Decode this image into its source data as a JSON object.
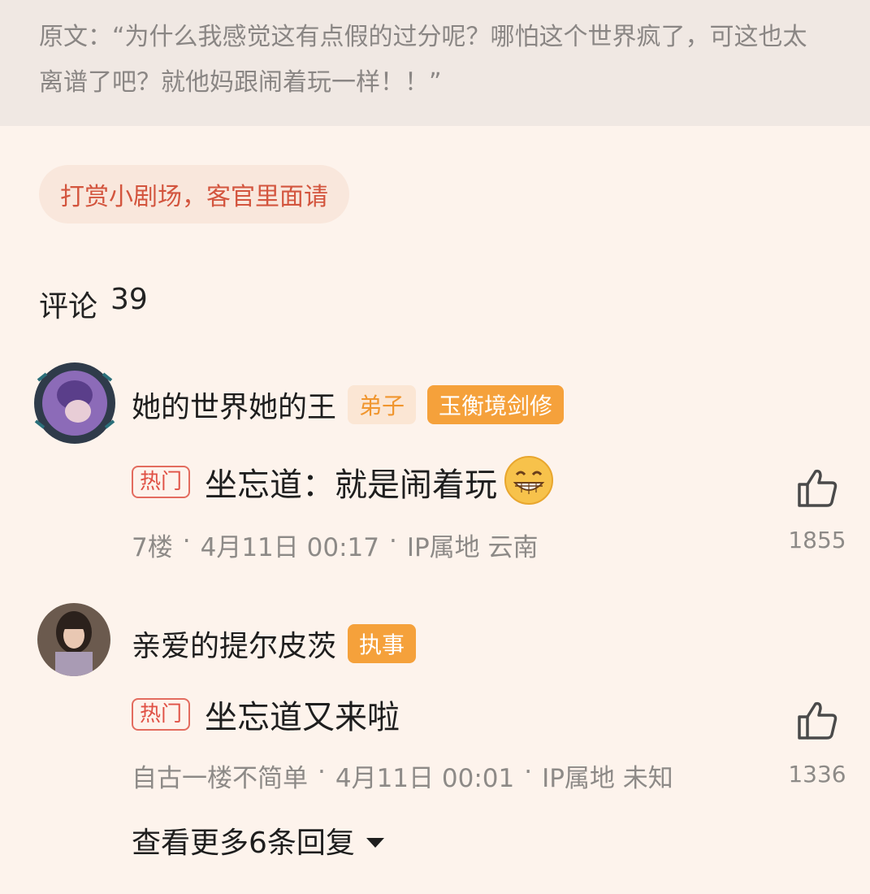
{
  "quote": {
    "text": "原文：“为什么我感觉这有点假的过分呢？哪怕这个世界疯了，可这也太离谱了吧？就他妈跟闹着玩一样！！”"
  },
  "reward": {
    "label": "打赏小剧场，客官里面请"
  },
  "comments_header": {
    "label": "评论",
    "count": "39"
  },
  "comments": [
    {
      "username": "她的世界她的王",
      "badges": [
        "弟子",
        "玉衡境剑修"
      ],
      "hot_tag": "热门",
      "text": "坐忘道：就是闹着玩",
      "meta": {
        "floor": "7楼",
        "datetime": "4月11日 00:17",
        "ip": "IP属地 云南"
      },
      "likes": "1855"
    },
    {
      "username": "亲爱的提尔皮茨",
      "badges": [
        "执事"
      ],
      "hot_tag": "热门",
      "text": "坐忘道又来啦",
      "meta": {
        "floor": "自古一楼不简单",
        "datetime": "4月11日 00:01",
        "ip": "IP属地 未知"
      },
      "likes": "1336"
    }
  ],
  "more_replies": {
    "label": "查看更多6条回复"
  },
  "colors": {
    "background": "#fdf3ec",
    "badge_orange": "#f5a13b",
    "hot_red": "#e05145"
  },
  "icons": [
    "thumbs-up-icon",
    "grinning-emoji-icon",
    "caret-down-icon"
  ]
}
